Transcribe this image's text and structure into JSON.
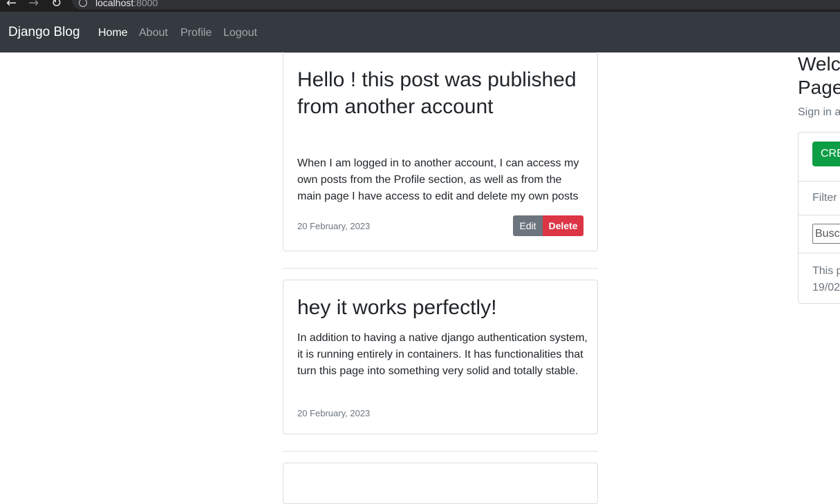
{
  "browser": {
    "url_host": "localhost",
    "url_port": ":8000"
  },
  "navbar": {
    "brand": "Django Blog",
    "links": [
      "Home",
      "About",
      "Profile",
      "Logout"
    ]
  },
  "posts": [
    {
      "title": "Hello ! this post was published from another account",
      "body": "When I am logged in to another account, I can access my own posts from the Profile section, as well as from the main page I have access to edit and delete my own posts",
      "date": "20 February, 2023",
      "edit_label": "Edit",
      "delete_label": "Delete"
    },
    {
      "title": "hey it works perfectly!",
      "body": "In addition to having a native django authentication system, it is running entirely in containers. It has functionalities that turn this page into something very solid and totally stable.",
      "date": "20 February, 2023"
    }
  ],
  "sidebar": {
    "title_line1": "Welc",
    "title_line2": "Page",
    "lead": "Sign in a",
    "create_label": "CREATE",
    "filter_label": "Filter",
    "search_placeholder": "Buscar",
    "footer_line1": "This p",
    "footer_line2": "19/02"
  },
  "colors": {
    "navbar_bg": "#343a40",
    "edit_btn": "#6c757d",
    "delete_btn": "#dc3545",
    "create_btn": "#0d9d45"
  }
}
